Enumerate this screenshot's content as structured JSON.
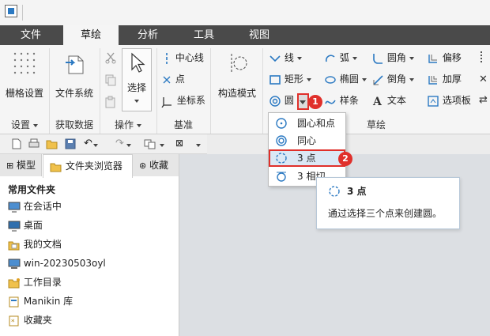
{
  "tabs": [
    "文件",
    "草绘",
    "分析",
    "工具",
    "视图"
  ],
  "ribbon": {
    "grid_settings": "栅格设置",
    "file_system": "文件系统",
    "select": "选择",
    "centerline": "中心线",
    "point": "点",
    "coord_sys": "坐标系",
    "construct_mode": "构造模式",
    "line": "线",
    "rect": "矩形",
    "circle": "圆",
    "arc": "弧",
    "ellipse": "椭圆",
    "spline": "样条",
    "fillet": "圆角",
    "chamfer": "倒角",
    "text": "文本",
    "offset": "偏移",
    "thicken": "加厚",
    "palette": "选项板",
    "groups": {
      "settings": "设置",
      "get_data": "获取数据",
      "operations": "操作",
      "datum": "基准",
      "sketch": "草绘"
    }
  },
  "dropdown": {
    "items": [
      "圆心和点",
      "同心",
      "3 点",
      "3 相切"
    ]
  },
  "tooltip": {
    "title": "3 点",
    "text": "通过选择三个点来创建圆。"
  },
  "badges": [
    "1",
    "2"
  ],
  "panel": {
    "tabs": [
      "模型",
      "文件夹浏览器",
      "收藏"
    ],
    "header": "常用文件夹",
    "items": [
      "在会话中",
      "桌面",
      "我的文档",
      "win-20230503oyl",
      "工作目录",
      "Manikin 库",
      "收藏夹"
    ]
  },
  "colors": {
    "accent_red": "#e0302b",
    "icon_blue": "#2b79c2"
  }
}
